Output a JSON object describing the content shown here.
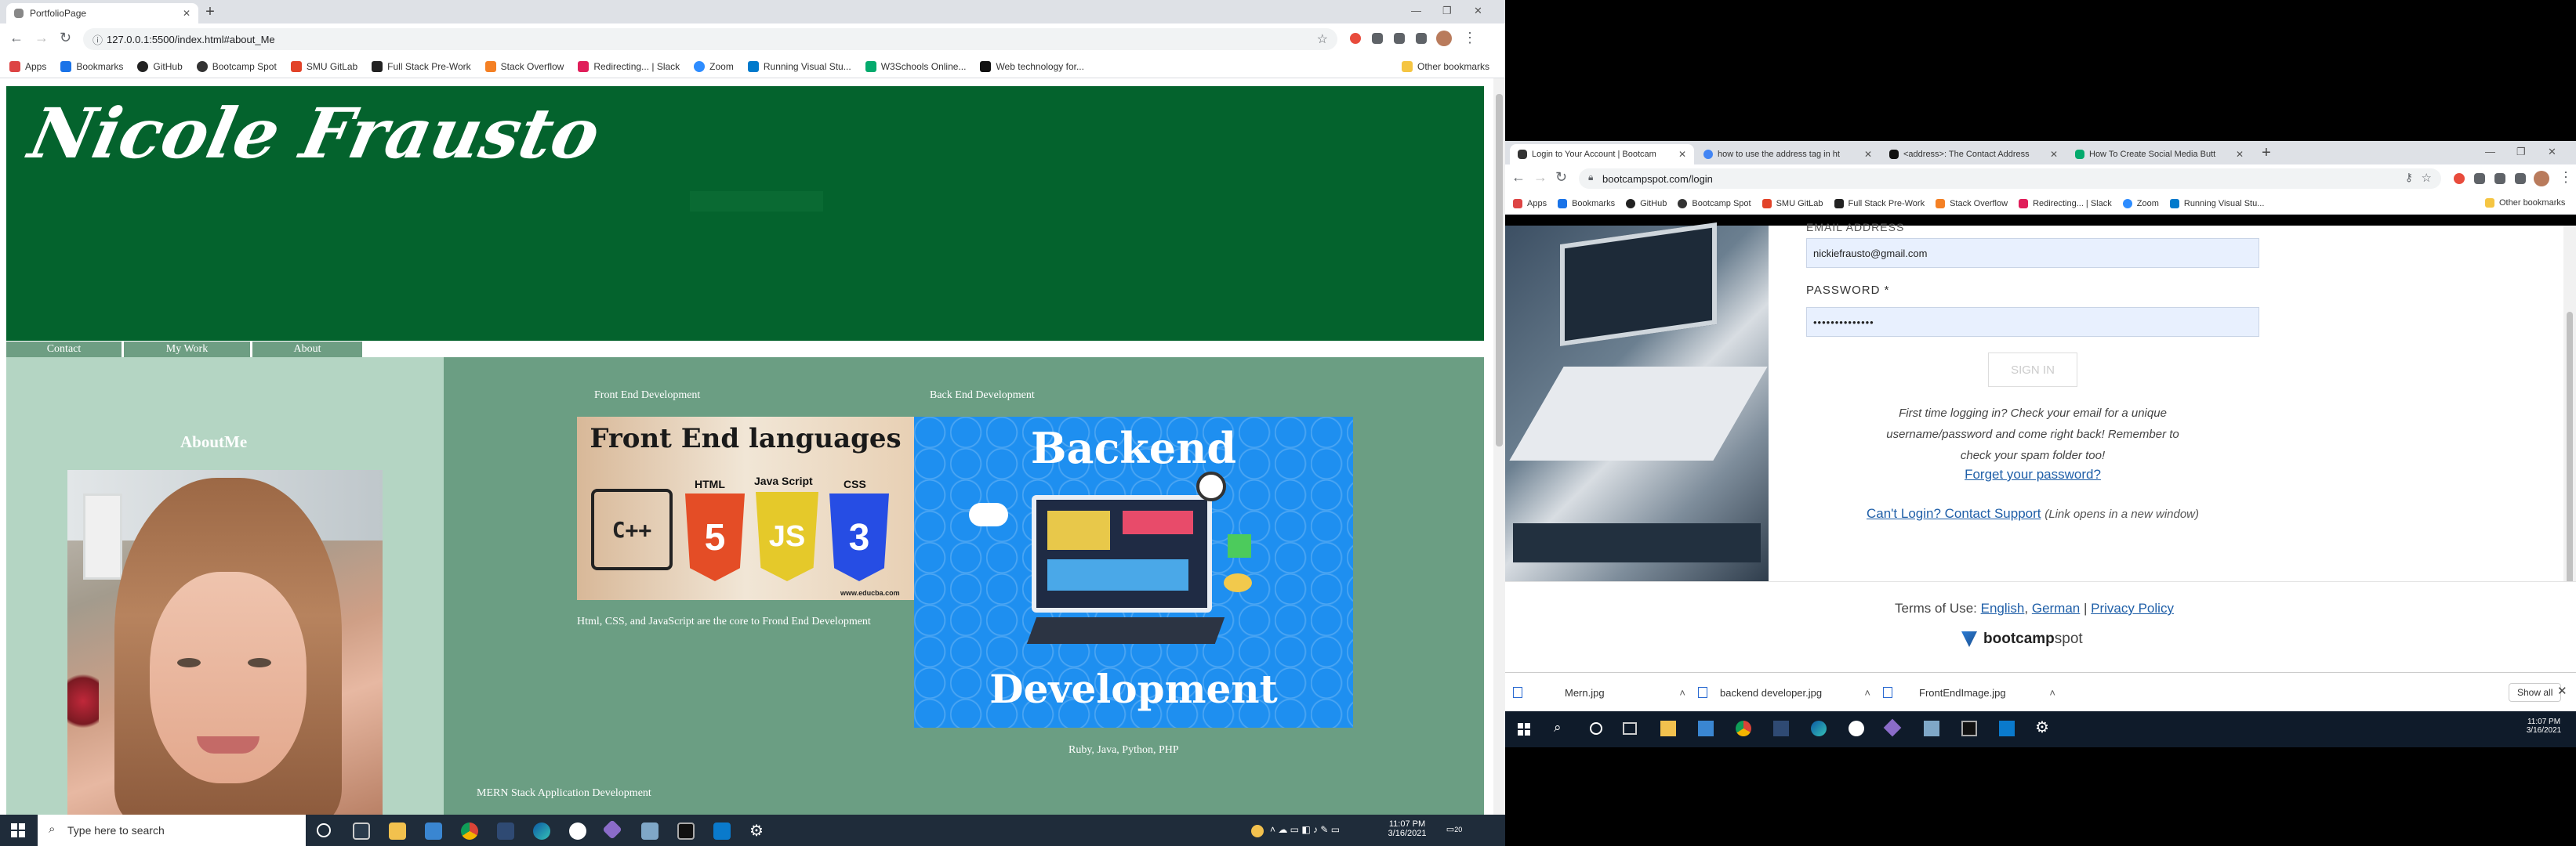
{
  "left_browser": {
    "tab_title": "PortfolioPage",
    "url": "127.0.0.1:5500/index.html#about_Me",
    "bookmarks": [
      "Apps",
      "Bookmarks",
      "GitHub",
      "Bootcamp Spot",
      "SMU GitLab",
      "Full Stack Pre-Work",
      "Stack Overflow",
      "Redirecting... | Slack",
      "Zoom",
      "Running Visual Stu...",
      "W3Schools Online...",
      "Web technology for..."
    ],
    "other_bookmarks": "Other bookmarks"
  },
  "portfolio": {
    "name": "Nicole Frausto",
    "nav": [
      "Contact",
      "My Work",
      "About"
    ],
    "about_heading": "AboutMe",
    "front_label": "Front End Development",
    "back_label": "Back End Development",
    "front_image_title": "Front End languages",
    "front_image_langs": [
      "HTML",
      "Java Script",
      "CSS"
    ],
    "front_image_cpp": "C++",
    "front_image_site": "www.educba.com",
    "front_caption": "Html, CSS, and JavaScript are the core to Frond End Development",
    "back_image_title_top": "Backend",
    "back_image_title_bottom": "Development",
    "back_caption": "Ruby, Java, Python, PHP",
    "mern_label": "MERN Stack Application Development"
  },
  "left_taskbar": {
    "search_placeholder": "Type here to search",
    "time": "11:07 PM",
    "date": "3/16/2021",
    "notif_count": "20"
  },
  "right_browser": {
    "tabs": [
      "Login to Your Account | Bootcam",
      "how to use the address tag in ht",
      "<address>: The Contact Address",
      "How To Create Social Media Butt"
    ],
    "url": "bootcampspot.com/login",
    "bookmarks": [
      "Apps",
      "Bookmarks",
      "GitHub",
      "Bootcamp Spot",
      "SMU GitLab",
      "Full Stack Pre-Work",
      "Stack Overflow",
      "Redirecting... | Slack",
      "Zoom",
      "Running Visual Stu..."
    ],
    "other_bookmarks": "Other bookmarks"
  },
  "login": {
    "email_label_partial": "EMAIL ADDRESS",
    "email_value": "nickiefrausto@gmail.com",
    "password_label": "PASSWORD *",
    "password_value": "••••••••••••••",
    "sign_in": "SIGN IN",
    "first_time_line1": "First time logging in? Check your email for a unique",
    "first_time_line2": "username/password and come right back! Remember to",
    "first_time_line3": "check your spam folder too!",
    "forgot": "Forget your password?",
    "cant_login": "Can't Login? Contact Support",
    "new_window": "(Link opens in a new window)",
    "terms_prefix": "Terms of Use:",
    "terms_english": "English",
    "terms_german": "German",
    "privacy": "Privacy Policy",
    "brand_bold": "bootcamp",
    "brand_light": "spot"
  },
  "downloads": {
    "items": [
      "Mern.jpg",
      "backend developer.jpg",
      "FrontEndImage.jpg"
    ],
    "show_all": "Show all"
  },
  "right_taskbar": {
    "time": "11:07 PM",
    "date": "3/16/2021"
  }
}
